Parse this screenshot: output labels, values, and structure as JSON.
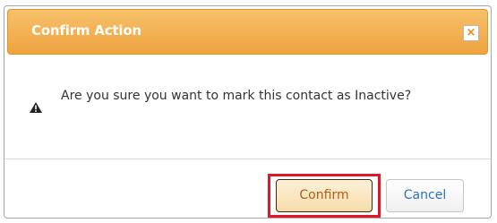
{
  "dialog": {
    "title": "Confirm Action",
    "close_label": "×",
    "message": "Are you sure you want to mark this contact as Inactive?",
    "icon": "warning-icon",
    "buttons": {
      "confirm_label": "Confirm",
      "cancel_label": "Cancel"
    }
  },
  "colors": {
    "titlebar": "#eea33f",
    "confirm_text": "#b35b12",
    "cancel_text": "#2a73b8",
    "highlight": "#e0162b"
  }
}
